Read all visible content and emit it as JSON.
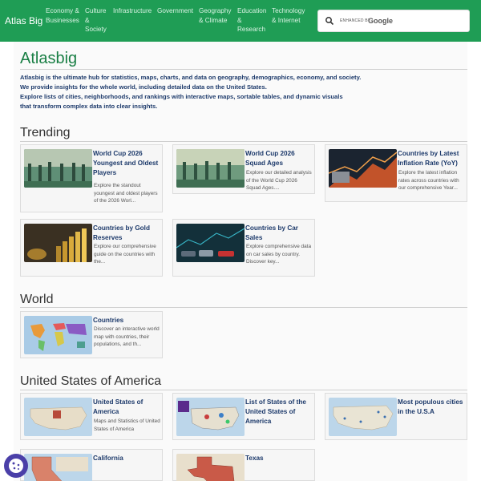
{
  "nav": {
    "brand": "Atlas Big",
    "items": [
      "Economy &\nBusinesses",
      "Culture\n&\nSociety",
      "Infrastructure",
      "Government",
      "Geography\n& Climate",
      "Education\n&\nResearch",
      "Technology\n& Internet"
    ],
    "search_enhanced": "ENHANCED BY",
    "search_google": "Google"
  },
  "header": {
    "title": "Atlasbig",
    "intro": [
      "Atlasbig is the ultimate hub for statistics, maps, charts, and data on geography, demographics, economy, and society.",
      "We provide insights for the whole world, including detailed data on the United States.",
      "Explore lists of cities, neighborhoods, and rankings with interactive maps, sortable tables, and dynamic visuals",
      "that transform complex data into clear insights."
    ]
  },
  "sections": {
    "trending": "Trending",
    "world": "World",
    "usa": "United States of America"
  },
  "cards": {
    "worldcup_oldest": {
      "title": "World Cup 2026 Youngest and Oldest Players",
      "desc": "Explore the standout youngest and oldest players of the 2026 Worl..."
    },
    "worldcup_squad": {
      "title": "World Cup 2026 Squad Ages",
      "desc": "Explore our detailed analysis of the World Cup 2026 Squad Ages...."
    },
    "inflation": {
      "title": "Countries by Latest Inflation Rate (YoY)",
      "desc": "Explore the latest inflation rates across countries with our comprehensive Year..."
    },
    "gold": {
      "title": "Countries by Gold Reserves",
      "desc": "Explore our comprehensive guide on the countries with the..."
    },
    "car_sales": {
      "title": "Countries by Car Sales",
      "desc": "Explore comprehensive data on car sales by country. Discover key..."
    },
    "countries": {
      "title": "Countries",
      "desc": "Discover an interactive world map with countries, their populations, and th..."
    },
    "usa": {
      "title": "United States of America",
      "desc": "Maps and Statistics of United States of America"
    },
    "states": {
      "title": "List of States of the United States of America",
      "desc": ""
    },
    "populous": {
      "title": "Most populous cities in the U.S.A",
      "desc": ""
    },
    "california": {
      "title": "California",
      "desc": ""
    },
    "texas": {
      "title": "Texas",
      "desc": ""
    }
  },
  "colors": {
    "nav_bg": "#1f9d55",
    "title_green": "#1a7f45",
    "link_blue": "#1d3a6b",
    "cookie": "#4a3fa8"
  },
  "icons": [
    "search-icon",
    "cookie-icon"
  ]
}
